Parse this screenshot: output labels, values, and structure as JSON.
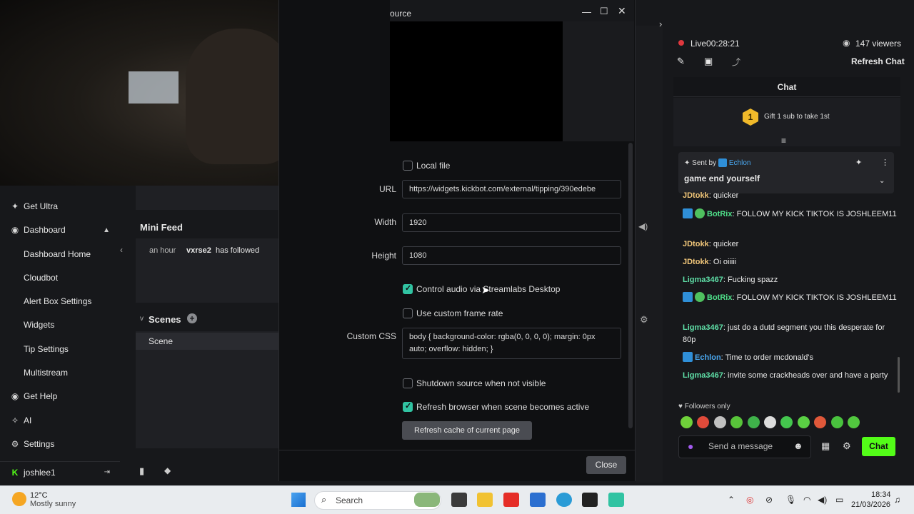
{
  "dialog": {
    "title_fragment": "ource",
    "local_file_label": "Local file",
    "url_label": "URL",
    "url_value": "https://widgets.kickbot.com/external/tipping/390edebe",
    "width_label": "Width",
    "width_value": "1920",
    "height_label": "Height",
    "height_value": "1080",
    "control_audio_label": "Control audio via Streamlabs Desktop",
    "custom_frame_rate_label": "Use custom frame rate",
    "custom_css_label": "Custom CSS",
    "custom_css_value": "body { background-color: rgba(0, 0, 0, 0); margin: 0px auto; overflow: hidden; }",
    "shutdown_label": "Shutdown source when not visible",
    "refresh_browser_label": "Refresh browser when scene becomes active",
    "refresh_cache_button": "Refresh cache of current page",
    "close_button": "Close",
    "control_audio_checked": true,
    "refresh_browser_checked": true,
    "local_file_checked": false,
    "custom_frame_rate_checked": false,
    "shutdown_checked": false
  },
  "sidebar": {
    "items": [
      {
        "label": "Get Ultra",
        "icon": "ultra-icon"
      },
      {
        "label": "Dashboard",
        "icon": "dashboard-icon"
      },
      {
        "label": "Dashboard Home"
      },
      {
        "label": "Cloudbot"
      },
      {
        "label": "Alert Box Settings"
      },
      {
        "label": "Widgets"
      },
      {
        "label": "Tip Settings"
      },
      {
        "label": "Multistream"
      },
      {
        "label": "Get Help",
        "icon": "help-icon"
      },
      {
        "label": "AI",
        "icon": "ai-icon"
      },
      {
        "label": "Settings",
        "icon": "gear-icon"
      }
    ],
    "user": "joshlee1"
  },
  "dock": {
    "mini_feed_title": "Mini Feed",
    "feed_time": "an hour",
    "feed_user": "vxrse2",
    "feed_action": "has followed",
    "scenes_title": "Scenes",
    "scene_item": "Scene"
  },
  "stream": {
    "live_label": "Live",
    "live_time": "00:28:21",
    "viewers": "147 viewers",
    "refresh_chat": "Refresh Chat",
    "chat_title": "Chat",
    "gift_text": "Gift 1 sub to take 1st",
    "gift_rank": "1",
    "pinned_sent_by": "Sent by",
    "pinned_user": "Echlon",
    "pinned_text": "game end yourself",
    "cut_msg_user": "JDtokk",
    "cut_msg_text": "quicker",
    "followers_only": "Followers only",
    "send_placeholder": "Send a message",
    "chat_button": "Chat"
  },
  "messages": [
    {
      "user": "BotRix",
      "text": "FOLLOW MY KICK TIKTOK IS JOSHLEEM11",
      "color": "#4fe08a",
      "badges": [
        "blue",
        "green"
      ]
    },
    {
      "user": "JDtokk",
      "text": "quicker",
      "color": "#f2c77a",
      "badges": []
    },
    {
      "user": "JDtokk",
      "text": "Oi oiiiii",
      "color": "#f2c77a",
      "badges": []
    },
    {
      "user": "Ligma3467",
      "text": "Fucking spazz",
      "color": "#5fe0a8",
      "badges": []
    },
    {
      "user": "BotRix",
      "text": "FOLLOW MY KICK TIKTOK IS JOSHLEEM11",
      "color": "#4fe08a",
      "badges": [
        "blue",
        "green"
      ]
    },
    {
      "user": "Ligma3467",
      "text": "just do a dutd segment you this desperate for 80p",
      "color": "#5fe0a8",
      "badges": []
    },
    {
      "user": "Echlon",
      "text": "Time to order mcdonald's",
      "color": "#4aa8f0",
      "badges": [
        "blue"
      ]
    },
    {
      "user": "Ligma3467",
      "text": "invite some crackheads over and have a party",
      "color": "#5fe0a8",
      "badges": []
    }
  ],
  "taskbar": {
    "weather_temp": "12°C",
    "weather_desc": "Mostly sunny",
    "search_label": "Search",
    "time": "18:34",
    "date": "21/03/2026"
  },
  "colors": {
    "accent": "#31c3a2",
    "kick_green": "#53fc18",
    "live_red": "#e0383e"
  }
}
